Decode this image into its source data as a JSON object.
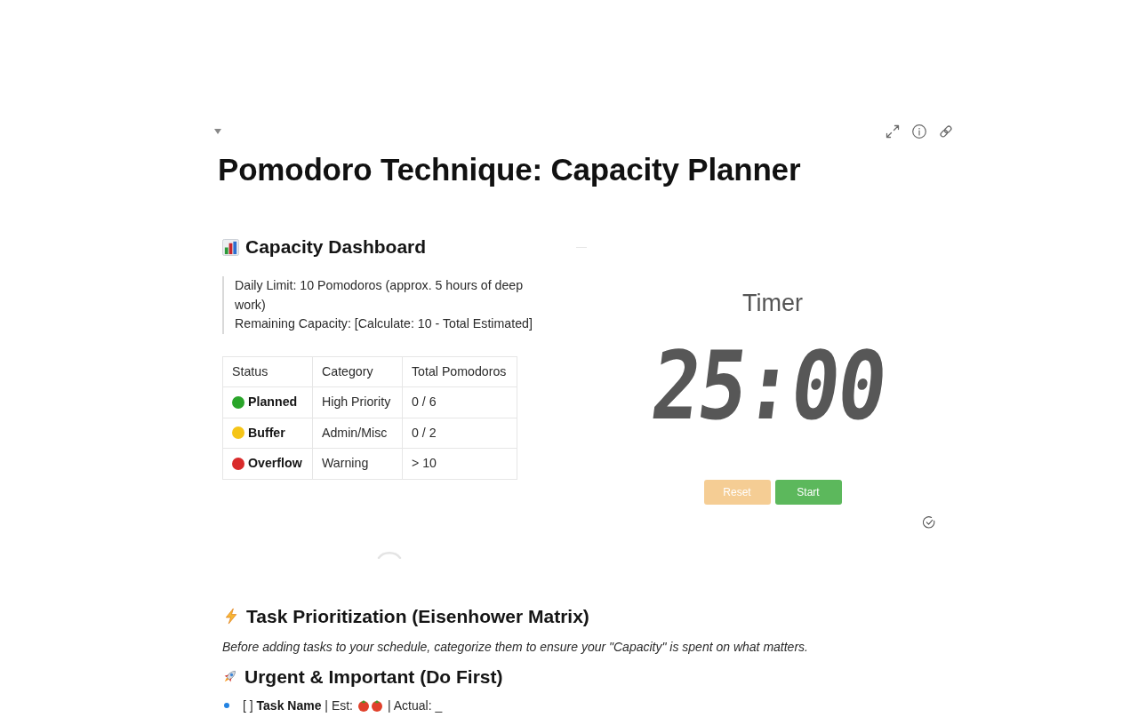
{
  "page": {
    "title": "Pomodoro Technique: Capacity Planner"
  },
  "dashboard": {
    "heading": "Capacity Dashboard",
    "quote": [
      "Daily Limit: 10 Pomodoros (approx. 5 hours of deep work)",
      "Remaining Capacity: [Calculate: 10 - Total Estimated]"
    ],
    "table": {
      "columns": [
        "Status",
        "Category",
        "Total Pomodoros"
      ],
      "rows": [
        {
          "status": "Planned",
          "color": "#2aa52a",
          "category": "High Priority",
          "total": "0 / 6"
        },
        {
          "status": "Buffer",
          "color": "#f5c518",
          "category": "Admin/Misc",
          "total": "0 / 2"
        },
        {
          "status": "Overflow",
          "color": "#d92b2b",
          "category": "Warning",
          "total": "> 10"
        }
      ]
    }
  },
  "timer": {
    "title": "Timer",
    "display": "25:00",
    "buttons": [
      {
        "label": "Reset",
        "kind": "reset",
        "disabled": true
      },
      {
        "label": "Start",
        "kind": "start",
        "disabled": false
      }
    ]
  },
  "tasks": {
    "heading": "Task Prioritization (Eisenhower Matrix)",
    "intro": "Before adding tasks to your schedule, categorize them to ensure your \"Capacity\" is spent on what matters.",
    "groups": [
      {
        "heading": "Urgent & Important (Do First)",
        "items": [
          {
            "text": "[ ] **Task Name** | Est:",
            "estimate": [
              {
                "kind": "tomato"
              },
              {
                "kind": "tomato"
              }
            ],
            "actual": "| Actual: _"
          }
        ]
      }
    ]
  }
}
